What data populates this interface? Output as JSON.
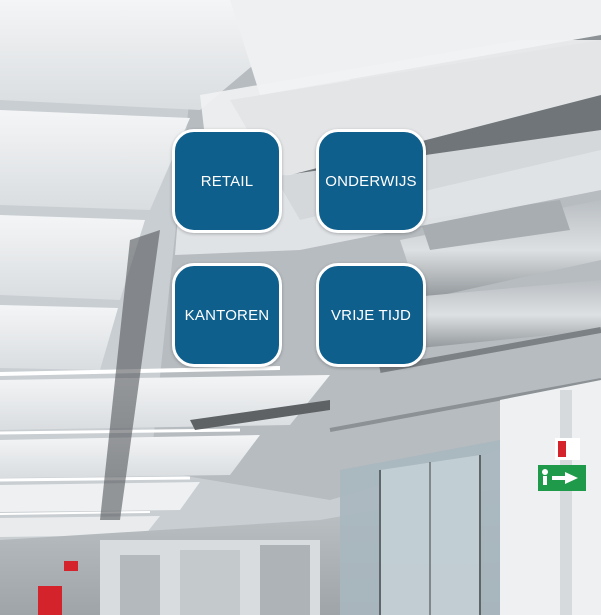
{
  "tiles": [
    {
      "label": "RETAIL"
    },
    {
      "label": "ONDERWIJS"
    },
    {
      "label": "KANTOREN"
    },
    {
      "label": "VRIJE TIJD"
    }
  ],
  "colors": {
    "tile_fill": "#0f5f8d",
    "tile_border": "#ffffff",
    "exit_sign": "#1f9a4a",
    "extinguisher": "#d4232b"
  },
  "icons": [
    "emergency-exit-icon",
    "fire-extinguisher-icon"
  ]
}
